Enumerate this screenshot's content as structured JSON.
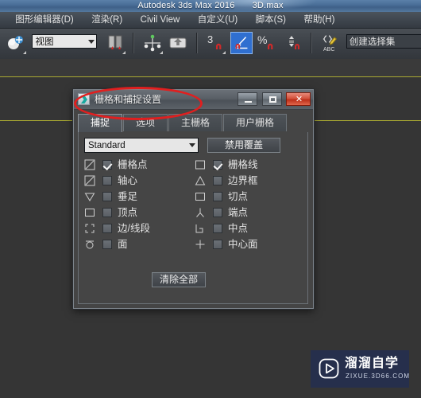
{
  "window": {
    "app_title": "Autodesk 3ds Max 2016",
    "file_name": "3D.max"
  },
  "menubar": {
    "items": [
      {
        "label": ")"
      },
      {
        "label": "图形编辑器(D)"
      },
      {
        "label": "渲染(R)"
      },
      {
        "label": "Civil View"
      },
      {
        "label": "自定义(U)"
      },
      {
        "label": "脚本(S)"
      },
      {
        "label": "帮助(H)"
      }
    ]
  },
  "toolbar": {
    "view_combo_value": "视图",
    "selection_set_combo_value": "创建选择集",
    "icons": [
      {
        "name": "select-and-link-icon"
      },
      {
        "name": "mirror-icon"
      },
      {
        "name": "align-icon"
      },
      {
        "name": "layer-explorer-icon"
      },
      {
        "name": "snaps-toggle-3-icon",
        "label": "3"
      },
      {
        "name": "angle-snap-toggle-icon",
        "active": true
      },
      {
        "name": "percent-snap-toggle-icon",
        "label": "%"
      },
      {
        "name": "spinner-snap-toggle-icon"
      },
      {
        "name": "named-selection-sets-icon"
      }
    ]
  },
  "dialog": {
    "title": "栅格和捕捉设置",
    "window_buttons": {
      "minimize": "minimize-button",
      "maximize": "maximize-button",
      "close": "✕"
    },
    "tabs": [
      {
        "label": "捕捉",
        "active": true
      },
      {
        "label": "选项",
        "active": false
      },
      {
        "label": "主栅格",
        "active": false
      },
      {
        "label": "用户栅格",
        "active": false
      }
    ],
    "snap_category_value": "Standard",
    "disable_override_label": "禁用覆盖",
    "clear_all_label": "清除全部",
    "snap_options_left": [
      {
        "glyph": "grid-point-glyph",
        "label": "栅格点",
        "checked": true
      },
      {
        "glyph": "pivot-glyph",
        "label": "轴心",
        "checked": false
      },
      {
        "glyph": "perpendicular-glyph",
        "label": "垂足",
        "checked": false
      },
      {
        "glyph": "vertex-glyph",
        "label": "顶点",
        "checked": false
      },
      {
        "glyph": "edge-segment-glyph",
        "label": "边/线段",
        "checked": false
      },
      {
        "glyph": "face-glyph",
        "label": "面",
        "checked": false
      }
    ],
    "snap_options_right": [
      {
        "glyph": "grid-line-glyph",
        "label": "栅格线",
        "checked": true
      },
      {
        "glyph": "bounding-box-glyph",
        "label": "边界框",
        "checked": false
      },
      {
        "glyph": "tangent-glyph",
        "label": "切点",
        "checked": false
      },
      {
        "glyph": "endpoint-glyph",
        "label": "端点",
        "checked": false
      },
      {
        "glyph": "midpoint-glyph",
        "label": "中点",
        "checked": false
      },
      {
        "glyph": "center-face-glyph",
        "label": "中心面",
        "checked": false
      }
    ]
  },
  "annotation": {
    "color": "#e01f1f",
    "shape": "ellipse-highlight"
  },
  "watermark": {
    "cn_text": "溜溜自学",
    "en_text": "ZIXUE.3D66.COM",
    "background": "#262f4c"
  }
}
